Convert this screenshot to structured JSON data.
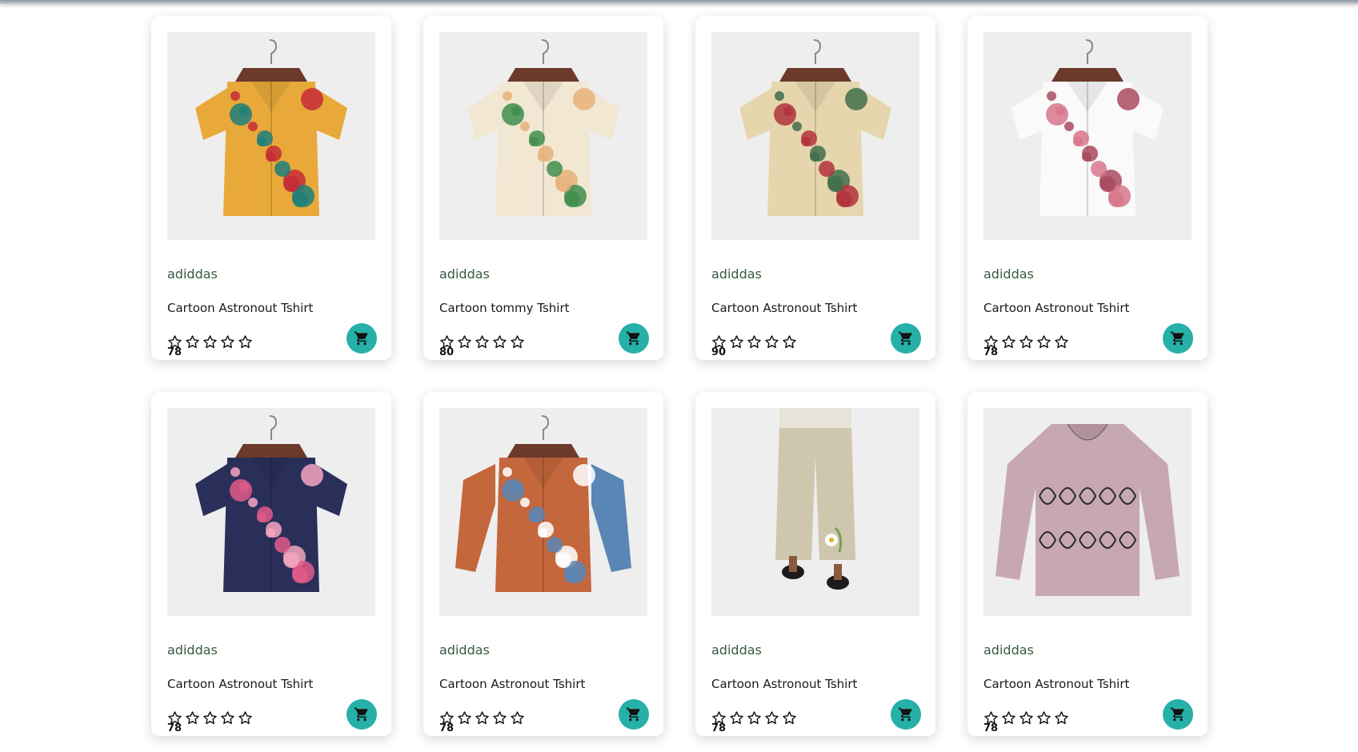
{
  "products": [
    {
      "brand": "adiddas",
      "title": "Cartoon Astronout Tshirt",
      "price": "78",
      "rating": 0,
      "image": "floral-shirt-teal-yellow",
      "colors": {
        "main": "#e8a93a",
        "accent": "#1d7f7a",
        "accent2": "#c62b37"
      }
    },
    {
      "brand": "adiddas",
      "title": "Cartoon tommy Tshirt",
      "price": "80",
      "rating": 0,
      "image": "floral-shirt-green-cream",
      "colors": {
        "main": "#f2e7d3",
        "accent": "#3f8e4c",
        "accent2": "#e8b27a"
      }
    },
    {
      "brand": "adiddas",
      "title": "Cartoon Astronout Tshirt",
      "price": "90",
      "rating": 0,
      "image": "floral-shirt-beige-red",
      "colors": {
        "main": "#e6d6ae",
        "accent": "#b2323c",
        "accent2": "#3f6e4a"
      }
    },
    {
      "brand": "adiddas",
      "title": "Cartoon Astronout Tshirt",
      "price": "78",
      "rating": 0,
      "image": "blossom-shirt-white-pink",
      "colors": {
        "main": "#fafafa",
        "accent": "#d8758c",
        "accent2": "#a94a5e"
      }
    },
    {
      "brand": "adiddas",
      "title": "Cartoon Astronout Tshirt",
      "price": "78",
      "rating": 0,
      "image": "floral-shirt-navy-pink",
      "colors": {
        "main": "#2a2f5a",
        "accent": "#e05a8a",
        "accent2": "#f4a6c0"
      }
    },
    {
      "brand": "adiddas",
      "title": "Cartoon Astronout Tshirt",
      "price": "78",
      "rating": 0,
      "image": "colorblock-shirt-rust-denim",
      "colors": {
        "main": "#c4673c",
        "accent": "#5a86b5",
        "accent2": "#ffffff"
      }
    },
    {
      "brand": "adiddas",
      "title": "Cartoon Astronout Tshirt",
      "price": "78",
      "rating": 0,
      "image": "linen-pants-beige",
      "colors": {
        "main": "#cfc6ae",
        "accent": "#e8e4da",
        "accent2": "#1c1c1c"
      }
    },
    {
      "brand": "adiddas",
      "title": "Cartoon Astronout Tshirt",
      "price": "78",
      "rating": 0,
      "image": "cat-print-blouse-mauve",
      "colors": {
        "main": "#c7a8b0",
        "accent": "#2b2b2b",
        "accent2": "#b3919a"
      }
    }
  ],
  "cart_color": "#26b0a8",
  "cart_icon": "shopping-cart-icon",
  "star_icon": "star-outline-icon"
}
